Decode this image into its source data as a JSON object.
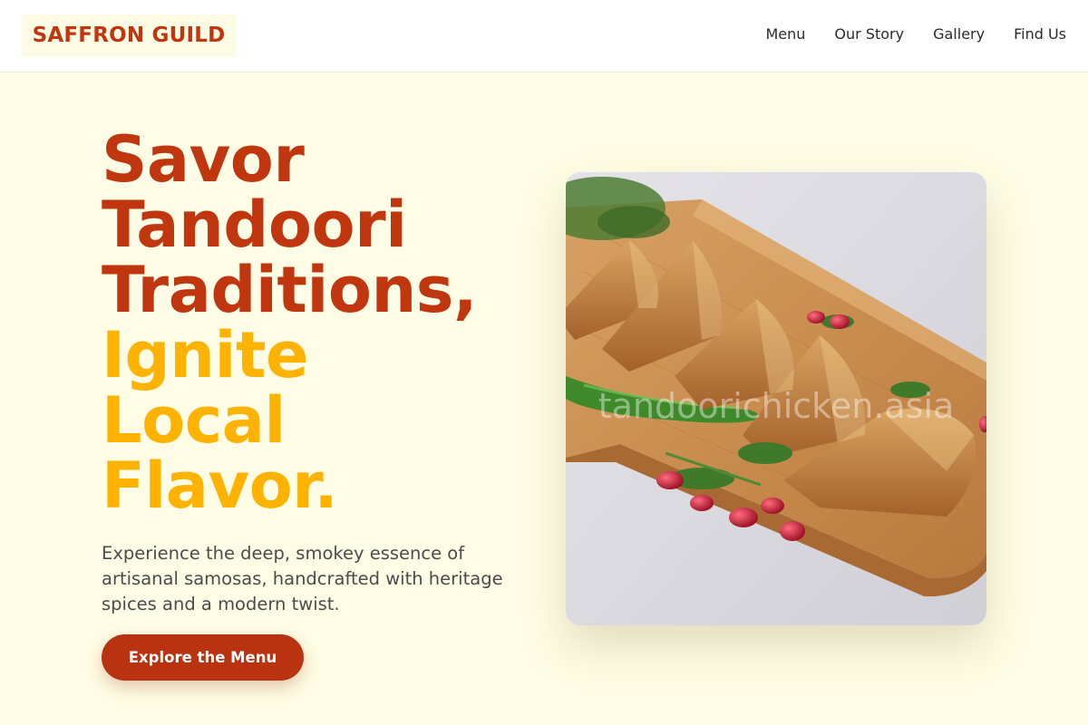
{
  "header": {
    "logo": "SAFFRON GUILD",
    "nav": [
      {
        "label": "Menu"
      },
      {
        "label": "Our Story"
      },
      {
        "label": "Gallery"
      },
      {
        "label": "Find Us"
      }
    ]
  },
  "hero": {
    "title_lines": [
      {
        "text": "Savor",
        "tone": "accent"
      },
      {
        "text": "Tandoori",
        "tone": "accent"
      },
      {
        "text": "Traditions,",
        "tone": "accent"
      },
      {
        "text": "Ignite",
        "tone": "highlight"
      },
      {
        "text": "Local",
        "tone": "highlight"
      },
      {
        "text": "Flavor.",
        "tone": "highlight"
      }
    ],
    "description": "Experience the deep, smokey essence of artisanal samosas, handcrafted with heritage spices and a modern twist.",
    "cta_label": "Explore the Menu"
  },
  "image": {
    "subject": "samosas on a wooden serving board with green chili, cilantro and pomegranate seeds",
    "watermark": "tandoorichicken.asia"
  },
  "colors": {
    "accent": "#c0360f",
    "highlight": "#ffb300",
    "background": "#fffde5",
    "button": "#b93310"
  }
}
